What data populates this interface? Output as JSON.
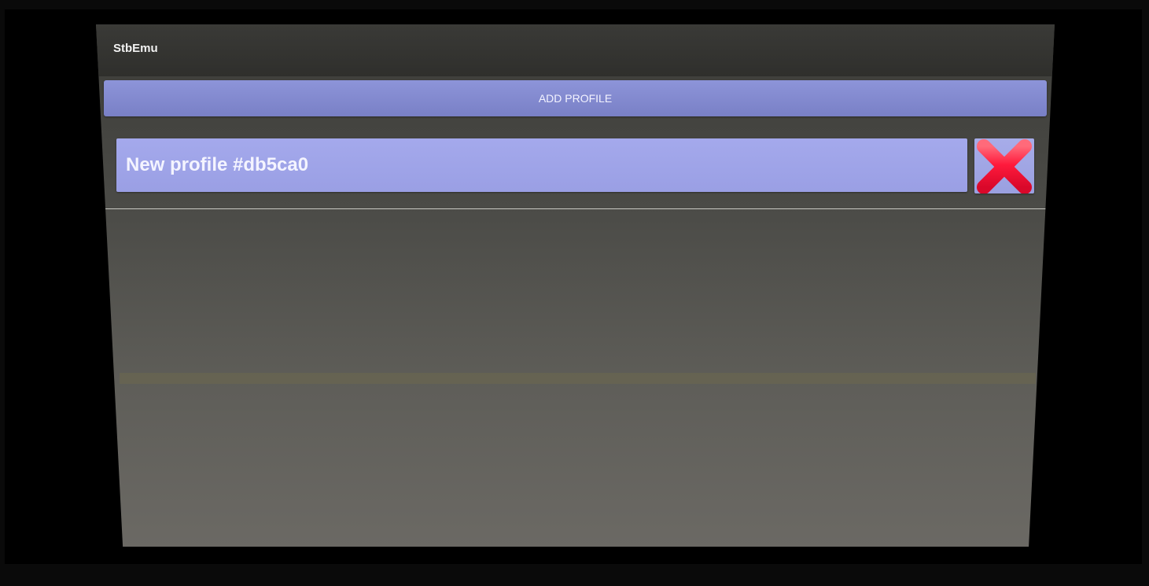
{
  "app": {
    "title": "StbEmu"
  },
  "toolbar": {
    "add_profile_label": "ADD PROFILE"
  },
  "profiles": [
    {
      "name": "New profile #db5ca0"
    }
  ],
  "icons": {
    "delete": "close-x-icon"
  },
  "colors": {
    "button": "#7f86cf",
    "profile_item": "#a1a6e8",
    "delete_x": "#ff1a3c",
    "background": "#4f4e4a"
  }
}
